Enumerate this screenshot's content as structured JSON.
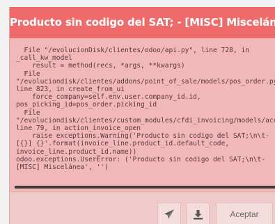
{
  "dialog": {
    "title": "Producto sin codigo del SAT; - [MISC] Miscelánea",
    "header_color": "#ee6a6b",
    "body_color": "#f2b7b8",
    "traceback_lines": [
      "  File \"/evolucionDisk/clientes/odoo/api.py\", line 728, in",
      "_call_kw_model",
      "    result = method(recs, *args, **kwargs)",
      "  File",
      "\"/evoluciondisk/clientes/addons/point_of_sale/models/pos_order.py\",",
      "line 823, in create_from_ui",
      "    force_company=self.env.user.company_id.id,",
      "pos_picking_id=pos_order.picking_id",
      "  File",
      "\"/evoluciondisk/clientes/custom_modules/cfdi_invoicing/models/account_invoice.py\",",
      "line 79, in action_invoice_open",
      "    raise exceptions.Warning('Producto sin codigo del SAT;\\n\\t-",
      "[{}] {}'.format(invoice_line.product_id.default_code,",
      "invoice_line.product_id.name))",
      "odoo.exceptions.UserError: ('Producto sin codigo del SAT;\\n\\t-",
      "[MISC] Miscelánea', '')"
    ]
  },
  "footer": {
    "send_icon": "paper-plane-icon",
    "download_icon": "download-icon",
    "accept_label": "Aceptar"
  }
}
